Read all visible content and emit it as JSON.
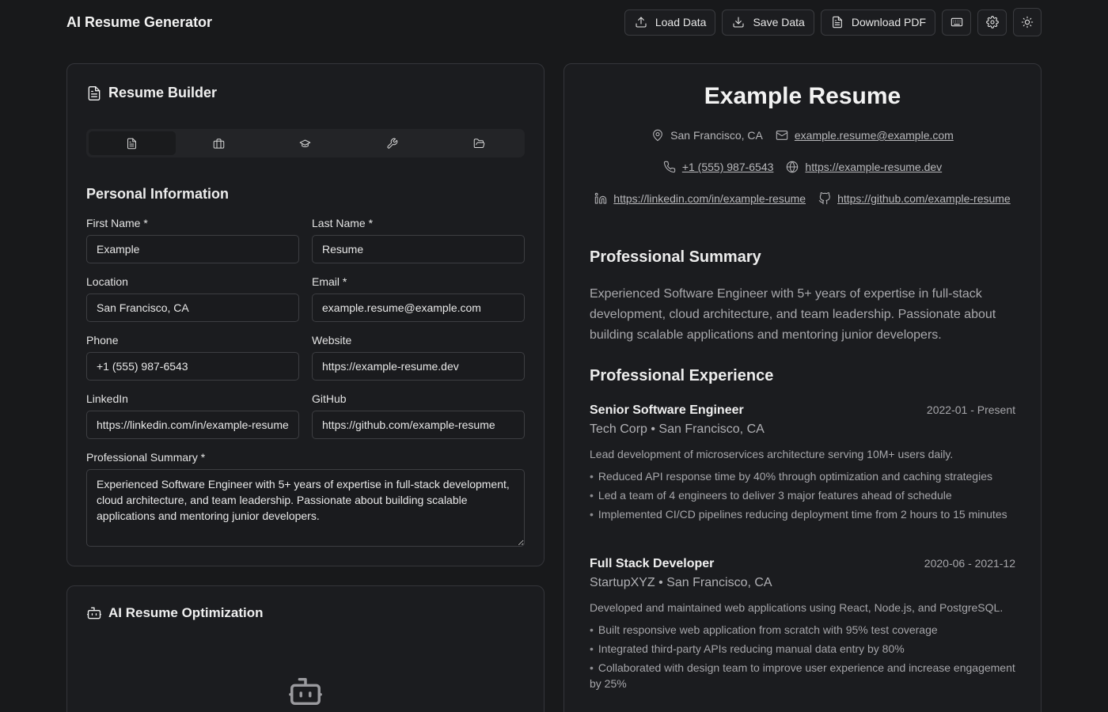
{
  "app": {
    "title": "AI Resume Generator"
  },
  "toolbar": {
    "load_label": "Load Data",
    "save_label": "Save Data",
    "download_label": "Download PDF"
  },
  "builder": {
    "title": "Resume Builder",
    "tabs": [
      {
        "icon": "document-icon",
        "active": true
      },
      {
        "icon": "briefcase-icon",
        "active": false
      },
      {
        "icon": "graduation-cap-icon",
        "active": false
      },
      {
        "icon": "wrench-icon",
        "active": false
      },
      {
        "icon": "folder-open-icon",
        "active": false
      }
    ],
    "section_title": "Personal Information",
    "fields": {
      "first_name": {
        "label": "First Name *",
        "value": "Example"
      },
      "last_name": {
        "label": "Last Name *",
        "value": "Resume"
      },
      "location": {
        "label": "Location",
        "value": "San Francisco, CA"
      },
      "email": {
        "label": "Email *",
        "value": "example.resume@example.com"
      },
      "phone": {
        "label": "Phone",
        "value": "+1 (555) 987-6543"
      },
      "website": {
        "label": "Website",
        "value": "https://example-resume.dev"
      },
      "linkedin": {
        "label": "LinkedIn",
        "value": "https://linkedin.com/in/example-resume"
      },
      "github": {
        "label": "GitHub",
        "value": "https://github.com/example-resume"
      },
      "summary": {
        "label": "Professional Summary *",
        "value": "Experienced Software Engineer with 5+ years of expertise in full-stack development, cloud architecture, and team leadership. Passionate about building scalable applications and mentoring junior developers."
      }
    }
  },
  "ai": {
    "title": "AI Resume Optimization"
  },
  "preview": {
    "name": "Example Resume",
    "location": "San Francisco, CA",
    "email": "example.resume@example.com",
    "phone": "+1 (555) 987-6543",
    "website": "https://example-resume.dev",
    "linkedin": "https://linkedin.com/in/example-resume",
    "github": "https://github.com/example-resume",
    "summary_heading": "Professional Summary",
    "summary": "Experienced Software Engineer with 5+ years of expertise in full-stack development, cloud architecture, and team leadership. Passionate about building scalable applications and mentoring junior developers.",
    "experience_heading": "Professional Experience",
    "jobs": [
      {
        "title": "Senior Software Engineer",
        "dates": "2022-01 - Present",
        "company": "Tech Corp • San Francisco, CA",
        "description": "Lead development of microservices architecture serving 10M+ users daily.",
        "bullets": [
          "Reduced API response time by 40% through optimization and caching strategies",
          "Led a team of 4 engineers to deliver 3 major features ahead of schedule",
          "Implemented CI/CD pipelines reducing deployment time from 2 hours to 15 minutes"
        ]
      },
      {
        "title": "Full Stack Developer",
        "dates": "2020-06 - 2021-12",
        "company": "StartupXYZ • San Francisco, CA",
        "description": "Developed and maintained web applications using React, Node.js, and PostgreSQL.",
        "bullets": [
          "Built responsive web application from scratch with 95% test coverage",
          "Integrated third-party APIs reducing manual data entry by 80%",
          "Collaborated with design team to improve user experience and increase engagement by 25%"
        ]
      }
    ]
  }
}
